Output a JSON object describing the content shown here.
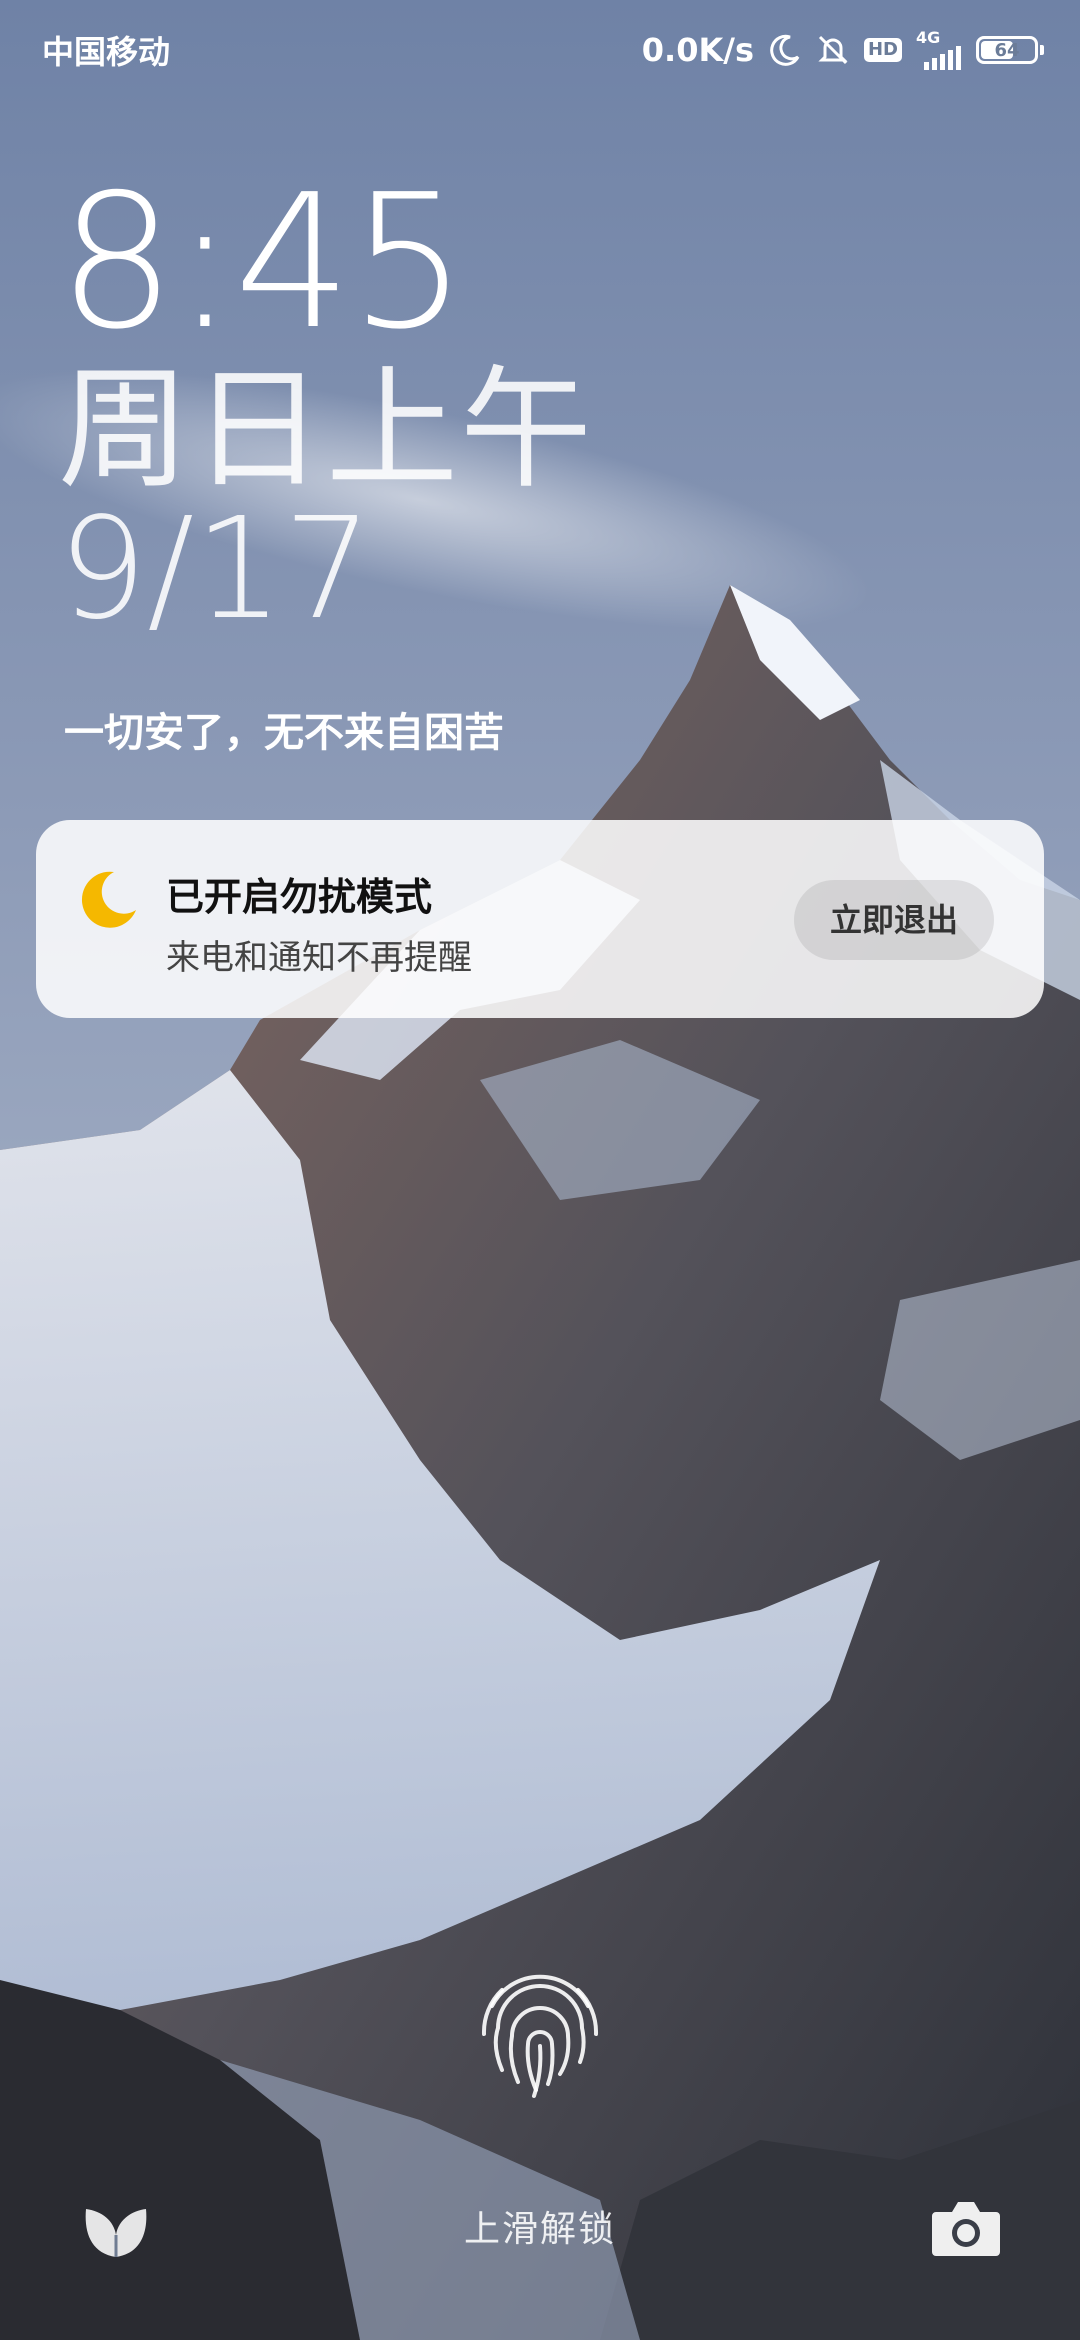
{
  "status_bar": {
    "carrier": "中国移动",
    "net_speed": "0.0K/s",
    "hd": "HD",
    "network_type": "4G",
    "battery": "64",
    "battery_level": 0.64,
    "icons": [
      "moon-icon",
      "bell-mute-icon",
      "hd-icon",
      "signal-icon",
      "battery-icon"
    ]
  },
  "lockscreen": {
    "time": "8:45",
    "weekday": "周日上午",
    "date": "9/17",
    "motto": "一切安了，无不来自困苦"
  },
  "dnd_notification": {
    "title": "已开启勿扰模式",
    "subtitle": "来电和通知不再提醒",
    "exit_label": "立即退出",
    "icon": "moon-icon",
    "icon_color": "#F5B800"
  },
  "bottom": {
    "unlock_hint": "上滑解锁",
    "left_icon": "app-shortcut-icon",
    "right_icon": "camera-icon",
    "fingerprint_icon": "fingerprint-icon"
  }
}
